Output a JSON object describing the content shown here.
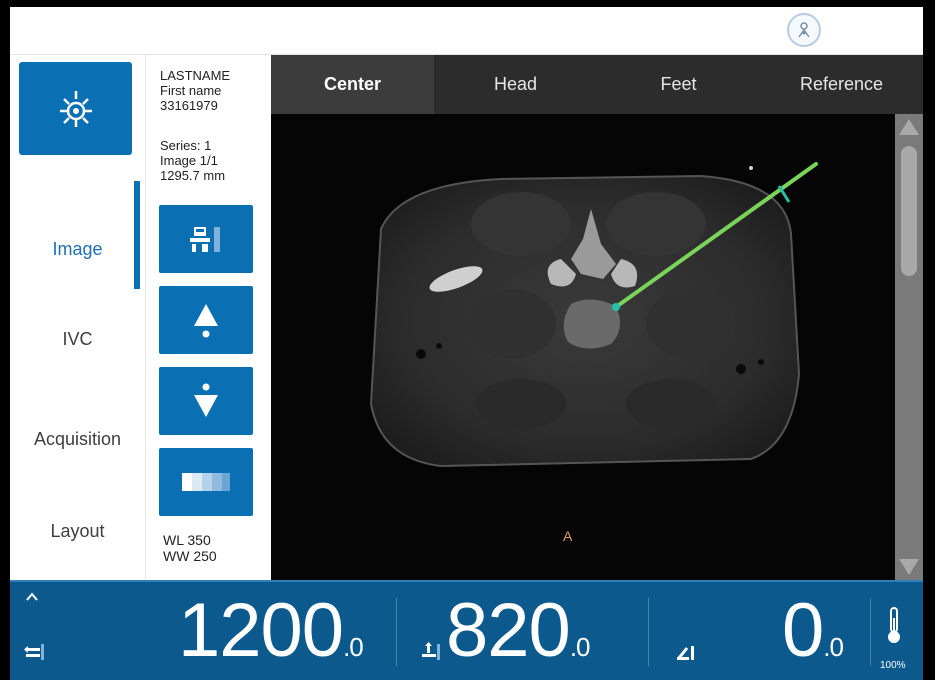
{
  "nav": {
    "items": [
      {
        "label": "Image",
        "active": true
      },
      {
        "label": "IVC",
        "active": false
      },
      {
        "label": "Acquisition",
        "active": false
      },
      {
        "label": "Layout",
        "active": false
      }
    ]
  },
  "patient": {
    "last_name": "LASTNAME",
    "first_name": "First name",
    "id": "33161979"
  },
  "series": {
    "series": "Series: 1",
    "image": "Image 1/1",
    "position": "1295.7 mm"
  },
  "window": {
    "wl": "WL 350",
    "ww": "WW 250"
  },
  "tabs": [
    {
      "label": "Center",
      "active": true
    },
    {
      "label": "Head",
      "active": false
    },
    {
      "label": "Feet",
      "active": false
    },
    {
      "label": "Reference",
      "active": false
    }
  ],
  "viewer": {
    "orientation_label": "A"
  },
  "bottom": {
    "value1_int": "1200",
    "value1_dec": ".0",
    "value2_int": "820",
    "value2_dec": ".0",
    "value3_int": "0",
    "value3_dec": ".0",
    "percent": "100%"
  },
  "colors": {
    "accent": "#0b6fb4",
    "bottombar": "#0c5a8d",
    "needle": "#7ad35a"
  }
}
